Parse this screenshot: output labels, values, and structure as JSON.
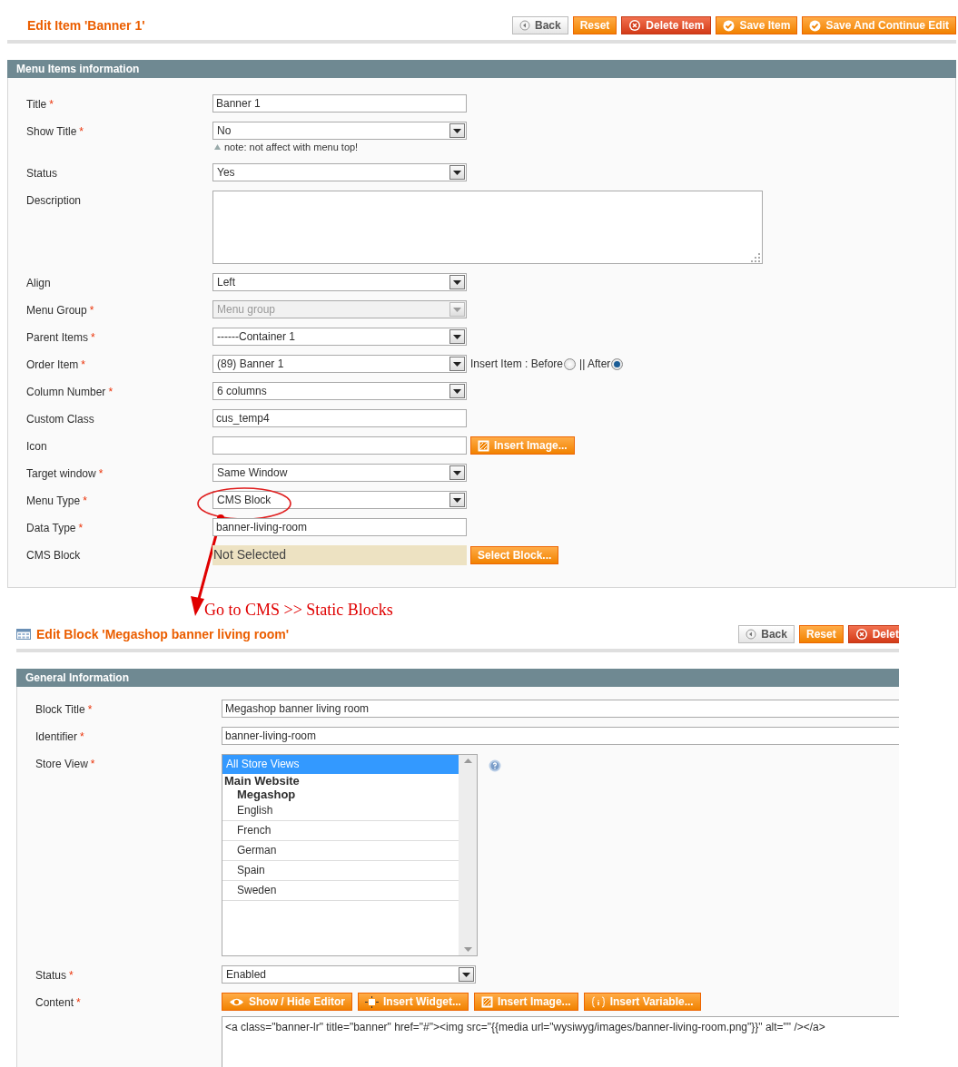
{
  "edit_item": {
    "title": "Edit Item 'Banner 1'",
    "buttons": [
      {
        "label": "Back",
        "kind": "back"
      },
      {
        "label": "Reset",
        "kind": "plain"
      },
      {
        "label": "Delete Item",
        "kind": "delete"
      },
      {
        "label": "Save Item",
        "kind": "save"
      },
      {
        "label": "Save And Continue Edit",
        "kind": "save"
      }
    ],
    "section": "Menu Items information",
    "fields": [
      {
        "label": "Title",
        "required_mark": "*",
        "kind": "text",
        "value": "Banner 1"
      },
      {
        "label": "Show Title",
        "required_mark": "*",
        "kind": "select",
        "value": "No",
        "disabled": false,
        "note": "note: not affect with menu top!"
      },
      {
        "label": "Status",
        "kind": "select",
        "value": "Yes",
        "disabled": false
      },
      {
        "label": "Description",
        "kind": "textarea"
      },
      {
        "label": "Align",
        "kind": "select",
        "value": "Left",
        "disabled": false
      },
      {
        "label": "Menu Group",
        "required_mark": "*",
        "kind": "select",
        "value": "Menu group",
        "disabled": true
      },
      {
        "label": "Parent Items",
        "required_mark": "*",
        "kind": "select",
        "value": "------Container 1",
        "disabled": false
      },
      {
        "label": "Order Item",
        "required_mark": "*",
        "kind": "select",
        "value": "(89) Banner 1",
        "disabled": false,
        "radios": [
          {
            "label": "Insert Item : Before",
            "selected": false
          },
          {
            "label": "|| After",
            "selected": true
          }
        ]
      },
      {
        "label": "Column Number",
        "required_mark": "*",
        "kind": "select",
        "value": "6 columns",
        "disabled": false
      },
      {
        "label": "Custom Class",
        "kind": "text",
        "value": "cus_temp4"
      },
      {
        "label": "Icon",
        "kind": "text",
        "button": {
          "label": "Insert Image...",
          "kind": "image"
        }
      },
      {
        "label": "Target window",
        "required_mark": "*",
        "kind": "select",
        "value": "Same Window",
        "disabled": false
      },
      {
        "label": "Menu Type",
        "required_mark": "*",
        "kind": "select",
        "value": "CMS Block",
        "disabled": false,
        "circled": true
      },
      {
        "label": "Data Type",
        "required_mark": "*",
        "kind": "text",
        "value": "banner-living-room"
      },
      {
        "label": "CMS Block",
        "kind": "readonly",
        "value": "Not Selected",
        "button": {
          "label": "Select Block...",
          "kind": "plain"
        }
      }
    ]
  },
  "annotation": "Go to CMS >> Static Blocks",
  "edit_block": {
    "title": "Edit Block 'Megashop banner living room'",
    "buttons": [
      {
        "label": "Back",
        "kind": "back"
      },
      {
        "label": "Reset",
        "kind": "plain"
      },
      {
        "label": "Delet",
        "kind": "delete"
      }
    ],
    "section": "General Information",
    "fields": [
      {
        "label": "Block Title",
        "required_mark": "*",
        "kind": "wide_text",
        "value": "Megashop banner living room"
      },
      {
        "label": "Identifier",
        "required_mark": "*",
        "kind": "wide_text",
        "value": "banner-living-room"
      },
      {
        "label": "Store View",
        "required_mark": "*",
        "kind": "multiselect",
        "help": true,
        "options": [
          {
            "label": "All Store Views",
            "kind": "option",
            "selected": true
          },
          {
            "label": "Main Website",
            "kind": "group"
          },
          {
            "label": "Megashop",
            "kind": "subgroup"
          },
          {
            "label": "English",
            "kind": "option",
            "selected": false
          },
          {
            "label": "French",
            "kind": "option",
            "selected": false
          },
          {
            "label": "German",
            "kind": "option",
            "selected": false
          },
          {
            "label": "Spain",
            "kind": "option",
            "selected": false
          },
          {
            "label": "Sweden",
            "kind": "option",
            "selected": false
          }
        ]
      },
      {
        "label": "Status",
        "required_mark": "*",
        "kind": "select",
        "value": "Enabled",
        "disabled": false
      },
      {
        "label": "Content",
        "required_mark": "*",
        "kind": "editor",
        "tools": [
          {
            "label": "Show / Hide Editor",
            "kind": "eye"
          },
          {
            "label": "Insert Widget...",
            "kind": "widget"
          },
          {
            "label": "Insert Image...",
            "kind": "image"
          },
          {
            "label": "Insert Variable...",
            "kind": "variable"
          }
        ],
        "value": "<a class=\"banner-lr\" title=\"banner\" href=\"#\"><img src=\"{{media url=\"wysiwyg/images/banner-living-room.png\"}}\" alt=\"\" /></a>"
      }
    ]
  }
}
